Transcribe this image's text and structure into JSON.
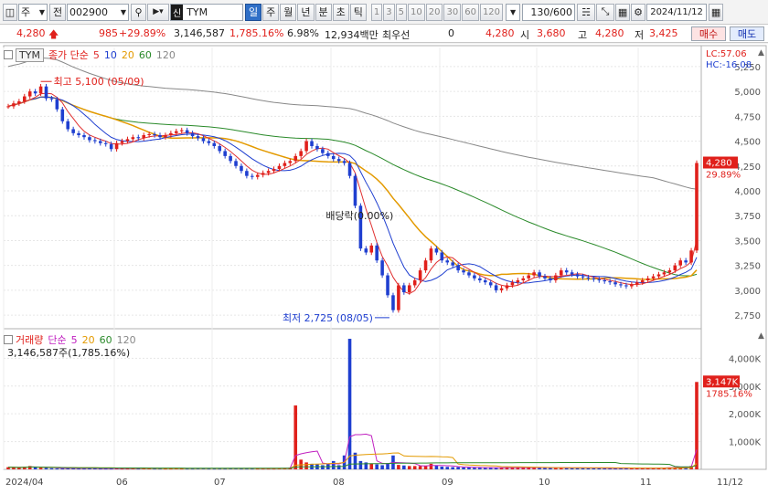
{
  "toolbar": {
    "market": "주",
    "mode": "전",
    "code": "002900",
    "badge": "신",
    "name": "TYM",
    "periods": [
      "일",
      "주",
      "월",
      "년",
      "분",
      "초",
      "틱"
    ],
    "active_period": "일",
    "ranges": [
      "1",
      "3",
      "5",
      "10",
      "20",
      "30",
      "60",
      "120"
    ],
    "count": "130",
    "count_total": "/600",
    "date": "2024/11/12",
    "icons": [
      "chart-type-icon",
      "search-icon",
      "volume-icon",
      "candle-settings-icon",
      "draw-tools-icon",
      "layout-icon",
      "gear-icon",
      "calendar-icon"
    ]
  },
  "info": {
    "price": "4,280",
    "change": "985",
    "change_pct": "+29.89%",
    "volume": "3,146,587",
    "volume_pct": "1,785.16%",
    "turnover": "6.98%",
    "amount": "12,934백만",
    "pref_label": "최우선",
    "pref_value": "0",
    "ask": "4,280",
    "open_label": "시",
    "open": "3,680",
    "high_label": "고",
    "high": "4,280",
    "low_label": "저",
    "low": "3,425",
    "buy": "매수",
    "sell": "매도"
  },
  "price_panel": {
    "symbol": "TYM",
    "legend_title": "종가 단순",
    "ma": [
      {
        "period": "5",
        "color": "#e03030"
      },
      {
        "period": "10",
        "color": "#1f3fd0"
      },
      {
        "period": "20",
        "color": "#e39a00"
      },
      {
        "period": "60",
        "color": "#2a8a2a"
      },
      {
        "period": "120",
        "color": "#888888"
      }
    ],
    "lc": "LC:57.06",
    "hc": "HC:-16.08",
    "high_note": "최고 5,100 (05/09)",
    "low_note": "최저 2,725 (08/05)",
    "dividend_note": "배당락(0.00%)",
    "last_price_tag": "4,280",
    "last_pct_tag": "29.89%",
    "axis": [
      "5,250",
      "5,000",
      "4,750",
      "4,500",
      "4,250",
      "4,000",
      "3,750",
      "3,500",
      "3,250",
      "3,000",
      "2,750"
    ]
  },
  "volume_panel": {
    "legend_title": "거래량",
    "legend_ma_title": "단순",
    "ma": [
      {
        "period": "5",
        "color": "#c020c0"
      },
      {
        "period": "20",
        "color": "#e39a00"
      },
      {
        "period": "60",
        "color": "#2a8a2a"
      },
      {
        "period": "120",
        "color": "#888888"
      }
    ],
    "subtitle": "3,146,587주(1,785.16%)",
    "axis": [
      "4,000K",
      "3,000K",
      "2,000K",
      "1,000K"
    ],
    "last_tag": "3,147K",
    "last_pct_tag": "1785.16%"
  },
  "x_axis": [
    "2024/04",
    "06",
    "07",
    "08",
    "09",
    "10",
    "11",
    "11/12"
  ],
  "chart_data": {
    "type": "candlestick",
    "period": "daily",
    "x_ticks": [
      "2024/04",
      "06",
      "07",
      "08",
      "09",
      "10",
      "11",
      "11/12"
    ],
    "price_ylim": [
      2650,
      5350
    ],
    "volume_ylim": [
      0,
      4800000
    ],
    "high": {
      "value": 5100,
      "date": "05/09"
    },
    "low": {
      "value": 2725,
      "date": "08/05"
    },
    "close_series": [
      4850,
      4880,
      4900,
      4950,
      5000,
      4980,
      5050,
      4930,
      4920,
      4820,
      4700,
      4620,
      4580,
      4560,
      4540,
      4510,
      4500,
      4480,
      4470,
      4420,
      4480,
      4500,
      4520,
      4540,
      4530,
      4560,
      4570,
      4560,
      4540,
      4560,
      4580,
      4600,
      4610,
      4580,
      4550,
      4530,
      4500,
      4480,
      4450,
      4400,
      4350,
      4300,
      4250,
      4200,
      4150,
      4140,
      4160,
      4180,
      4200,
      4220,
      4250,
      4280,
      4300,
      4350,
      4400,
      4500,
      4450,
      4420,
      4380,
      4350,
      4320,
      4300,
      4280,
      4150,
      3850,
      3420,
      3380,
      3450,
      3300,
      3150,
      2950,
      2800,
      3050,
      2980,
      3050,
      3100,
      3200,
      3300,
      3420,
      3380,
      3300,
      3280,
      3250,
      3200,
      3180,
      3150,
      3120,
      3100,
      3080,
      3050,
      3000,
      3020,
      3050,
      3080,
      3100,
      3120,
      3150,
      3180,
      3140,
      3120,
      3100,
      3150,
      3200,
      3180,
      3160,
      3140,
      3130,
      3120,
      3110,
      3100,
      3090,
      3080,
      3060,
      3050,
      3040,
      3060,
      3080,
      3100,
      3120,
      3140,
      3160,
      3180,
      3200,
      3250,
      3300,
      3280,
      3400,
      4280
    ],
    "volume_series": [
      80000,
      70000,
      60000,
      90000,
      120000,
      80000,
      60000,
      50000,
      40000,
      30000,
      30000,
      40000,
      50000,
      30000,
      30000,
      40000,
      40000,
      30000,
      30000,
      30000,
      40000,
      30000,
      30000,
      40000,
      30000,
      40000,
      40000,
      30000,
      30000,
      30000,
      30000,
      40000,
      30000,
      30000,
      30000,
      40000,
      40000,
      30000,
      30000,
      30000,
      30000,
      40000,
      40000,
      30000,
      30000,
      30000,
      30000,
      30000,
      30000,
      30000,
      40000,
      50000,
      60000,
      2300000,
      350000,
      250000,
      200000,
      180000,
      150000,
      200000,
      300000,
      150000,
      500000,
      4700000,
      600000,
      300000,
      250000,
      200000,
      180000,
      150000,
      220000,
      500000,
      160000,
      140000,
      120000,
      120000,
      120000,
      130000,
      200000,
      140000,
      100000,
      90000,
      80000,
      80000,
      70000,
      70000,
      60000,
      60000,
      60000,
      60000,
      60000,
      60000,
      70000,
      70000,
      60000,
      60000,
      60000,
      80000,
      60000,
      50000,
      50000,
      60000,
      60000,
      50000,
      50000,
      50000,
      50000,
      50000,
      50000,
      40000,
      40000,
      40000,
      40000,
      40000,
      40000,
      40000,
      40000,
      40000,
      50000,
      50000,
      50000,
      60000,
      70000,
      80000,
      90000,
      100000,
      120000,
      3146587
    ]
  }
}
